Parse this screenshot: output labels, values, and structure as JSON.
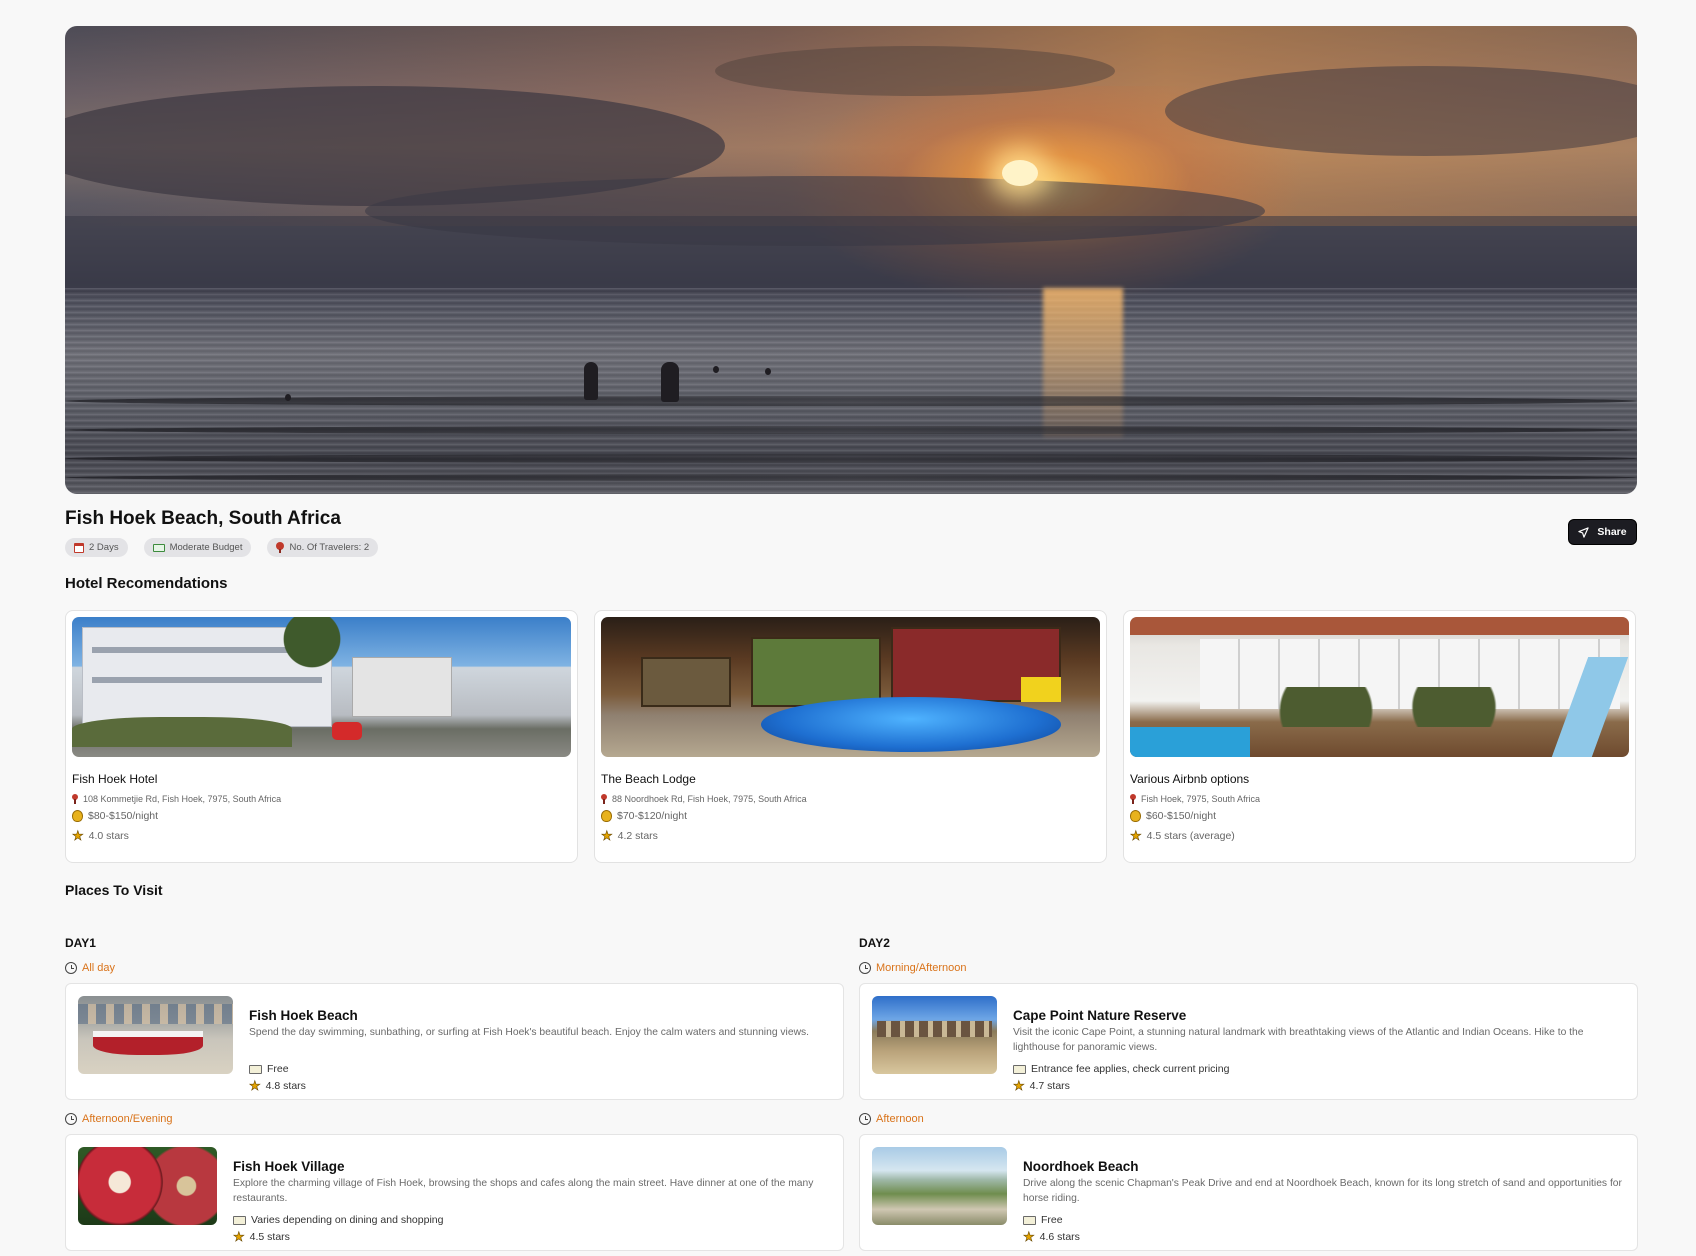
{
  "trip": {
    "title": "Fish Hoek Beach, South Africa",
    "chips": {
      "days": "2 Days",
      "budget": "Moderate Budget",
      "travelers": "No. Of Travelers: 2"
    },
    "share_label": "Share"
  },
  "hotels_section": {
    "title": "Hotel Recomendations",
    "items": [
      {
        "name": "Fish Hoek Hotel",
        "address": "108 Kommetjie Rd, Fish Hoek, 7975, South Africa",
        "price": "$80-$150/night",
        "rating": "4.0 stars"
      },
      {
        "name": "The Beach Lodge",
        "address": "88 Noordhoek Rd, Fish Hoek, 7975, South Africa",
        "price": "$70-$120/night",
        "rating": "4.2 stars"
      },
      {
        "name": "Various Airbnb options",
        "address": "Fish Hoek, 7975, South Africa",
        "price": "$60-$150/night",
        "rating": "4.5 stars (average)"
      }
    ]
  },
  "places_section": {
    "title": "Places To Visit",
    "days": [
      {
        "label": "DAY1",
        "slots": [
          {
            "time": "All day",
            "name": "Fish Hoek Beach",
            "description": "Spend the day swimming, sunbathing, or surfing at Fish Hoek's beautiful beach. Enjoy the calm waters and stunning views.",
            "cost": "Free",
            "rating": "4.8 stars"
          },
          {
            "time": "Afternoon/Evening",
            "name": "Fish Hoek Village",
            "description": "Explore the charming village of Fish Hoek, browsing the shops and cafes along the main street. Have dinner at one of the many restaurants.",
            "cost": "Varies depending on dining and shopping",
            "rating": "4.5 stars"
          }
        ]
      },
      {
        "label": "DAY2",
        "slots": [
          {
            "time": "Morning/Afternoon",
            "name": "Cape Point Nature Reserve",
            "description": "Visit the iconic Cape Point, a stunning natural landmark with breathtaking views of the Atlantic and Indian Oceans. Hike to the lighthouse for panoramic views.",
            "cost": "Entrance fee applies, check current pricing",
            "rating": "4.7 stars"
          },
          {
            "time": "Afternoon",
            "name": "Noordhoek Beach",
            "description": "Drive along the scenic Chapman's Peak Drive and end at Noordhoek Beach, known for its long stretch of sand and opportunities for horse riding.",
            "cost": "Free",
            "rating": "4.6 stars"
          }
        ]
      }
    ]
  },
  "colors": {
    "accent_time": "#d9731a",
    "share_bg": "#1c1c22",
    "chip_bg": "#e3e3e6",
    "page_bg": "#f8f8f8"
  },
  "icons": [
    "calendar-icon",
    "money-icon",
    "traveler-icon",
    "share-icon",
    "pin-icon",
    "moneybag-icon",
    "star-icon",
    "clock-icon",
    "ticket-icon"
  ]
}
